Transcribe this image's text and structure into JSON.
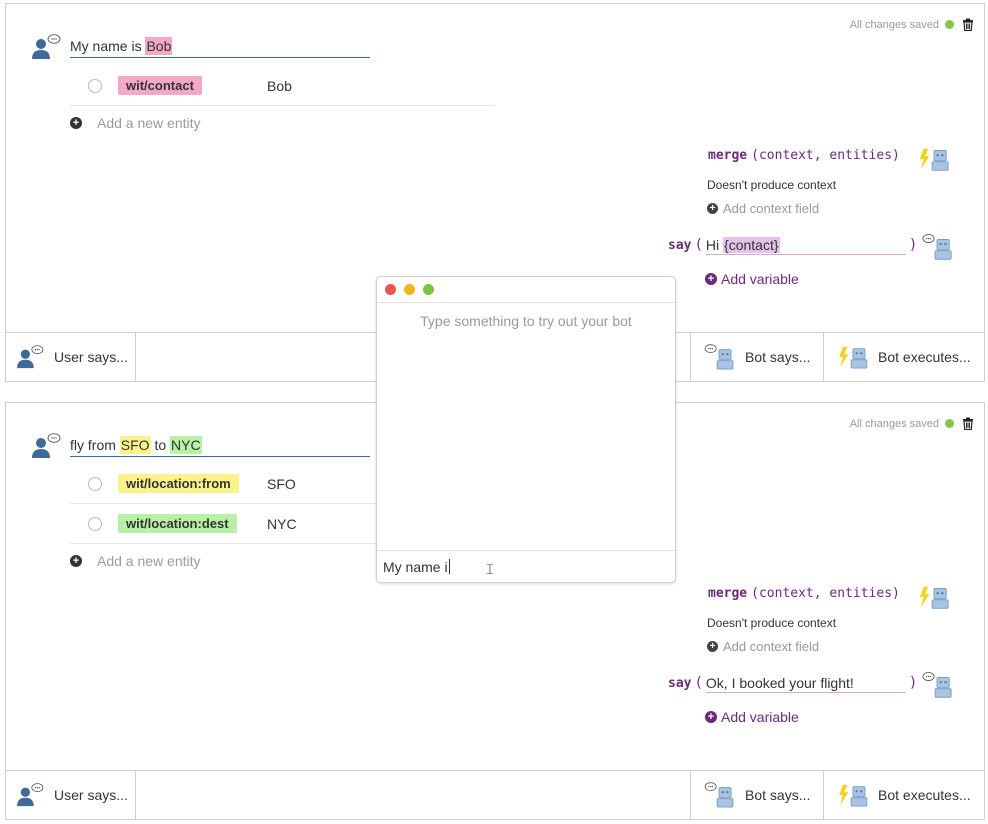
{
  "stories": [
    {
      "saved": "All changes saved",
      "user_text": {
        "pre": "My name is ",
        "e1": "Bob",
        "mid": "",
        "e2": ""
      },
      "entities": [
        {
          "tag": "wit/contact",
          "value": "Bob",
          "color": "#f4a8c8"
        }
      ],
      "add_entity": "Add a new entity",
      "merge_fn": "merge",
      "merge_args": "(context, entities)",
      "no_context": "Doesn't produce context",
      "add_context": "Add context field",
      "say_kw": "say",
      "say_pre": "Hi ",
      "say_var": "{contact}",
      "add_variable": "Add variable"
    },
    {
      "saved": "All changes saved",
      "user_text": {
        "pre": "fly from ",
        "e1": "SFO",
        "mid": " to ",
        "e2": "NYC"
      },
      "entities": [
        {
          "tag": "wit/location:from",
          "value": "SFO",
          "color": "#fbf38a"
        },
        {
          "tag": "wit/location:dest",
          "value": "NYC",
          "color": "#b8f0a6"
        }
      ],
      "add_entity": "Add a new entity",
      "merge_fn": "merge",
      "merge_args": "(context, entities)",
      "no_context": "Doesn't produce context",
      "add_context": "Add context field",
      "say_kw": "say",
      "say_text": "Ok, I booked your flight!",
      "add_variable": "Add variable"
    }
  ],
  "footer": {
    "user_says": "User says...",
    "bot_says": "Bot says...",
    "bot_executes": "Bot executes..."
  },
  "chat": {
    "placeholder": "Type something to try out your bot",
    "input_value": "My name i"
  },
  "colors": {
    "accent_purple": "#6b2a7c",
    "user_blue": "#2f6fb0",
    "saved_green": "#8bc34a"
  }
}
